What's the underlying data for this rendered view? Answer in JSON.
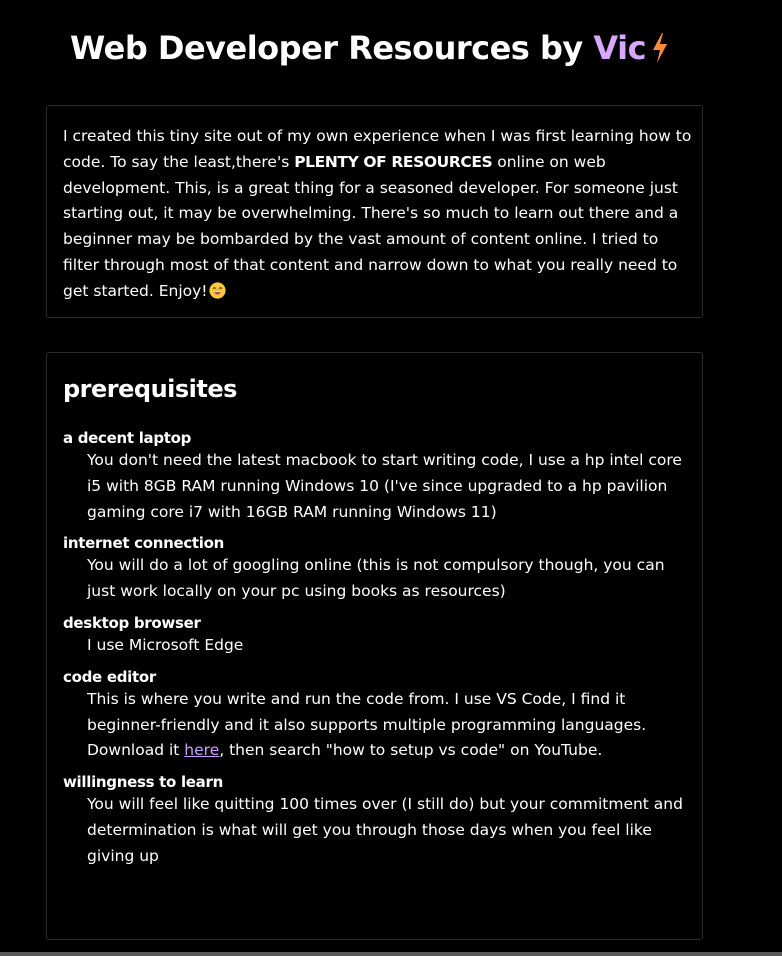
{
  "header": {
    "title_prefix": "Web Developer Resources by ",
    "title_name": "Vic",
    "bolt_icon": "lightning-icon",
    "accent_color": "#d8a8ff",
    "bolt_color": "#ff8a3d"
  },
  "intro": {
    "text_before_bold": "I created this tiny site out of my own experience when I was first learning how to code. To say the least,there's ",
    "bold_text": "PLENTY OF RESOURCES",
    "text_after_bold": " online on web development. This, is a great thing for a seasoned developer. For someone just starting out, it may be overwhelming. There's so much to learn out there and a beginner may be bombarded by the vast amount of content online. I tried to filter through most of that content and narrow down to what you really need to get started. Enjoy!",
    "emoji_icon": "grinning-face-emoji"
  },
  "prerequisites": {
    "heading": "prerequisites",
    "items": [
      {
        "title": "a decent laptop",
        "description": "You don't need the latest macbook to start writing code, I use a hp intel core i5 with 8GB RAM running Windows 10 (I've since upgraded to a hp pavilion gaming core i7 with 16GB RAM running Windows 11)"
      },
      {
        "title": "internet connection",
        "description": "You will do a lot of googling online (this is not compulsory though, you can just work locally on your pc using books as resources)"
      },
      {
        "title": "desktop browser",
        "description": "I use Microsoft Edge"
      },
      {
        "title": "code editor",
        "description_before_link": "This is where you write and run the code from. I use VS Code, I find it beginner-friendly and it also supports multiple programming languages. Download it ",
        "link_text": "here",
        "description_after_link": ", then search \"how to setup vs code\" on YouTube."
      },
      {
        "title": "willingness to learn",
        "description": "You will feel like quitting 100 times over (I still do) but your commitment and determination is what will get you through those days when you feel like giving up"
      }
    ]
  }
}
